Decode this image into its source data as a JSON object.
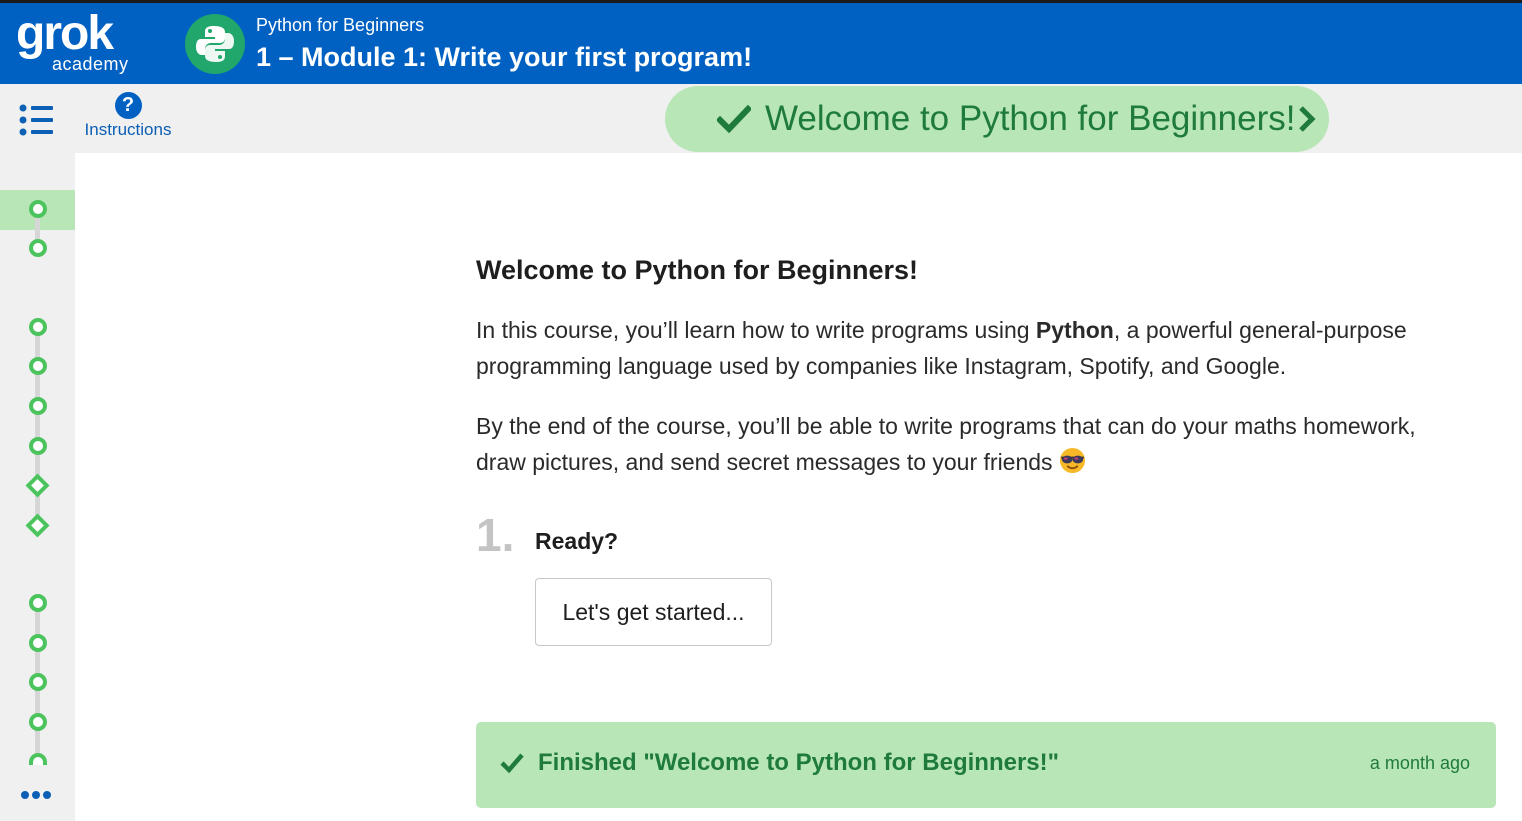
{
  "header": {
    "logo_text": "grok",
    "logo_sub": "academy",
    "course_name": "Python for Beginners",
    "module_title": "1 – Module 1: Write your first program!"
  },
  "toolbar": {
    "menu_icon": "list-icon",
    "instructions_icon": "help-icon",
    "instructions_label": "Instructions",
    "current_step": "Welcome to Python for Beginners!"
  },
  "sidebar": {
    "nodes": [
      "circle",
      "circle",
      "circle",
      "circle",
      "circle",
      "circle",
      "diamond",
      "diamond",
      "circle",
      "circle",
      "circle",
      "circle",
      "circle"
    ],
    "more_icon": "more-dots-icon",
    "accent_color": "#4cc45e"
  },
  "content": {
    "heading": "Welcome to Python for Beginners!",
    "p1_before": "In this course, you’ll learn how to write programs using ",
    "p1_bold": "Python",
    "p1_after": ", a powerful general-purpose programming language used by companies like Instagram, Spotify, and Google.",
    "p2": "By the end of the course, you’ll be able to write programs that can do your maths homework, draw pictures, and send secret messages to your friends ",
    "emoji": "sunglasses-emoji",
    "step_number": "1.",
    "step_label": "Ready?",
    "start_button": "Let's get started..."
  },
  "status": {
    "finished_text": "Finished \"Welcome to Python for Beginners!\"",
    "time": "a month ago",
    "color": "#b9e6b7",
    "text_color": "#1f7a3d"
  },
  "colors": {
    "brand_blue": "#0061c2",
    "success_green": "#1f7a3d"
  }
}
